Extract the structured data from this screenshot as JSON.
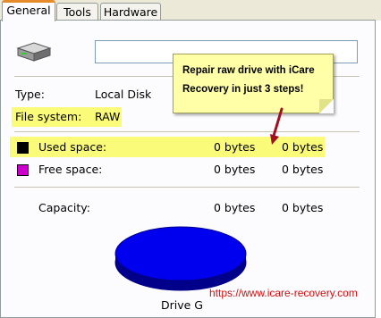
{
  "tabs": [
    {
      "label": "General",
      "active": true
    },
    {
      "label": "Tools",
      "active": false
    },
    {
      "label": "Hardware",
      "active": false
    }
  ],
  "drive": {
    "icon": "hard-drive-icon",
    "name_value": "",
    "type_label": "Type:",
    "type_value": "Local Disk",
    "filesystem_label": "File system:",
    "filesystem_value": "RAW"
  },
  "space": {
    "used_label": "Used space:",
    "used_bytes": "0 bytes",
    "used_size": "0 bytes",
    "used_color": "#000000",
    "free_label": "Free space:",
    "free_bytes": "0 bytes",
    "free_size": "0 bytes",
    "free_color": "#cc00cc",
    "capacity_label": "Capacity:",
    "capacity_bytes": "0 bytes",
    "capacity_size": "0 bytes"
  },
  "pie": {
    "color": "#0000ee",
    "label": "Drive G"
  },
  "callout": {
    "line1": "Repair raw drive with iCare",
    "line2": "Recovery in just 3 steps!"
  },
  "watermark": "https://www.icare-recovery.com",
  "colors": {
    "highlight": "#fbfb7a",
    "arrow": "#a01020",
    "tab_accent": "#e68b2c"
  }
}
